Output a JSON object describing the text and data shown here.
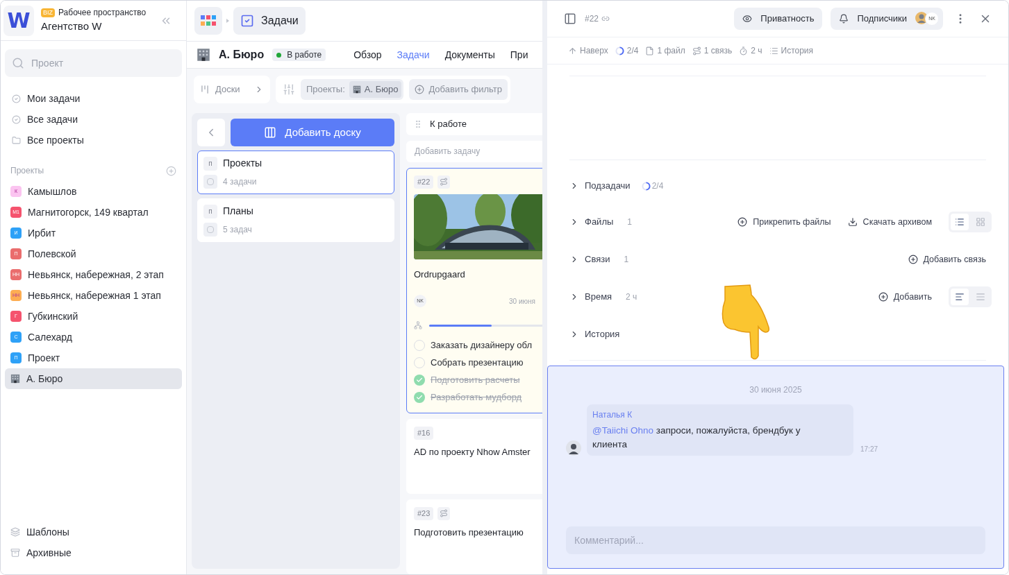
{
  "workspace": {
    "badge": "BIZ",
    "label": "Рабочее пространство",
    "name": "Агентство W",
    "logo": "W"
  },
  "sidebar": {
    "search_placeholder": "Проект",
    "nav": [
      {
        "kind": "check",
        "label": "Мои задачи"
      },
      {
        "kind": "check",
        "label": "Все задачи"
      },
      {
        "kind": "folder",
        "label": "Все проекты"
      }
    ],
    "projects_header": "Проекты",
    "projects": [
      {
        "initials": "К",
        "label": "Камышлов",
        "color": "#fbc4f0",
        "selected": false
      },
      {
        "initials": "М1",
        "label": "Магнитогорск, 149 квартал",
        "color": "#f5536e",
        "selected": false
      },
      {
        "initials": "И",
        "label": "Ирбит",
        "color": "#2ea1f7",
        "selected": false
      },
      {
        "initials": "П",
        "label": "Полевской",
        "color": "#ea6d6d",
        "selected": false
      },
      {
        "initials": "НН",
        "label": "Невьянск, набережная, 2 этап",
        "color": "#ea6d6d",
        "selected": false
      },
      {
        "initials": "НН",
        "label": "Невьянск, набережная 1 этап",
        "color": "#fdad52",
        "selected": false
      },
      {
        "initials": "Г",
        "label": "Губкинский",
        "color": "#f5536e",
        "selected": false
      },
      {
        "initials": "С",
        "label": "Салехард",
        "color": "#2ea1f7",
        "selected": false
      },
      {
        "initials": "П",
        "label": "Проект",
        "color": "#2ea1f7",
        "selected": false
      },
      {
        "kind": "building",
        "label": "А. Бюро",
        "selected": true
      }
    ],
    "footer": [
      {
        "kind": "templates",
        "label": "Шаблоны"
      },
      {
        "kind": "archive",
        "label": "Архивные"
      }
    ]
  },
  "breadcrumb": {
    "current": "Задачи"
  },
  "project": {
    "name": "А. Бюро",
    "status": "В работе"
  },
  "tabs": [
    {
      "label": "Обзор",
      "selected": false
    },
    {
      "label": "Задачи",
      "selected": true
    },
    {
      "label": "Документы",
      "selected": false
    },
    {
      "label": "При",
      "selected": false
    }
  ],
  "filters": {
    "boards": "Доски",
    "label": "Проекты:",
    "value": "А. Бюро",
    "add": "Добавить фильтр"
  },
  "boards": {
    "add": "Добавить доску",
    "items": [
      {
        "initial": "п",
        "name": "Проекты",
        "count": "4 задачи",
        "selected": true
      },
      {
        "initial": "п",
        "name": "Планы",
        "count": "5 задач",
        "selected": false
      }
    ]
  },
  "column": {
    "title": "К работе",
    "add_placeholder": "Добавить задачу",
    "cards": [
      {
        "number": "#22",
        "has_link": true,
        "picture": true,
        "title": "Ordrupgaard",
        "assignee": "NK",
        "date": "30 июня",
        "level": 0.5,
        "selected": true,
        "subtasks": [
          {
            "label": "Заказать дизайнеру обл",
            "checked": false
          },
          {
            "label": "Собрать презентацию",
            "checked": false
          },
          {
            "label": "Подготовить расчеты",
            "checked": true
          },
          {
            "label": "Разработать мудборд",
            "checked": true
          }
        ]
      },
      {
        "number": "#16",
        "has_link": false,
        "picture": false,
        "title": "AD по проекту Nhow Amster",
        "selected": false
      },
      {
        "number": "#23",
        "has_link": true,
        "picture": false,
        "title": "Подготовить презентацию",
        "selected": false
      }
    ]
  },
  "task": {
    "number": "#22",
    "privacy": "Приватность",
    "subscribers": "Подписчики",
    "subscriber_initials": "NK",
    "summary": [
      {
        "kind": "up",
        "label": "Наверх"
      },
      {
        "kind": "progress",
        "label": "2/4"
      },
      {
        "kind": "file",
        "label": "1 файл"
      },
      {
        "kind": "link",
        "label": "1 связь"
      },
      {
        "kind": "timer",
        "label": "2 ч"
      },
      {
        "kind": "list",
        "label": "История"
      }
    ],
    "sections": [
      {
        "title": "Подзадачи",
        "kind": "progress",
        "count": "2/4"
      },
      {
        "title": "Файлы",
        "count": "1",
        "actions": [
          {
            "kind": "add",
            "label": "Прикрепить файлы"
          },
          {
            "kind": "download",
            "label": "Скачать архивом"
          }
        ],
        "views": [
          {
            "kind": "list",
            "selected": true
          },
          {
            "kind": "grid",
            "selected": false
          }
        ]
      },
      {
        "title": "Связи",
        "count": "1",
        "actions": [
          {
            "kind": "add",
            "label": "Добавить связь"
          }
        ]
      },
      {
        "title": "Время",
        "count": "2 ч",
        "actions": [
          {
            "kind": "add",
            "label": "Добавить"
          }
        ],
        "views": [
          {
            "kind": "gantt",
            "selected": true
          },
          {
            "kind": "lines",
            "selected": false
          }
        ]
      },
      {
        "title": "История"
      }
    ]
  },
  "comments": {
    "date": "30 июня 2025",
    "messages": [
      {
        "author": "Наталья К",
        "mention": "@Taiichi Ohno",
        "text": "запроси, пожалуйста, брендбук у клиента",
        "time": "17:27"
      }
    ],
    "placeholder": "Комментарий..."
  }
}
